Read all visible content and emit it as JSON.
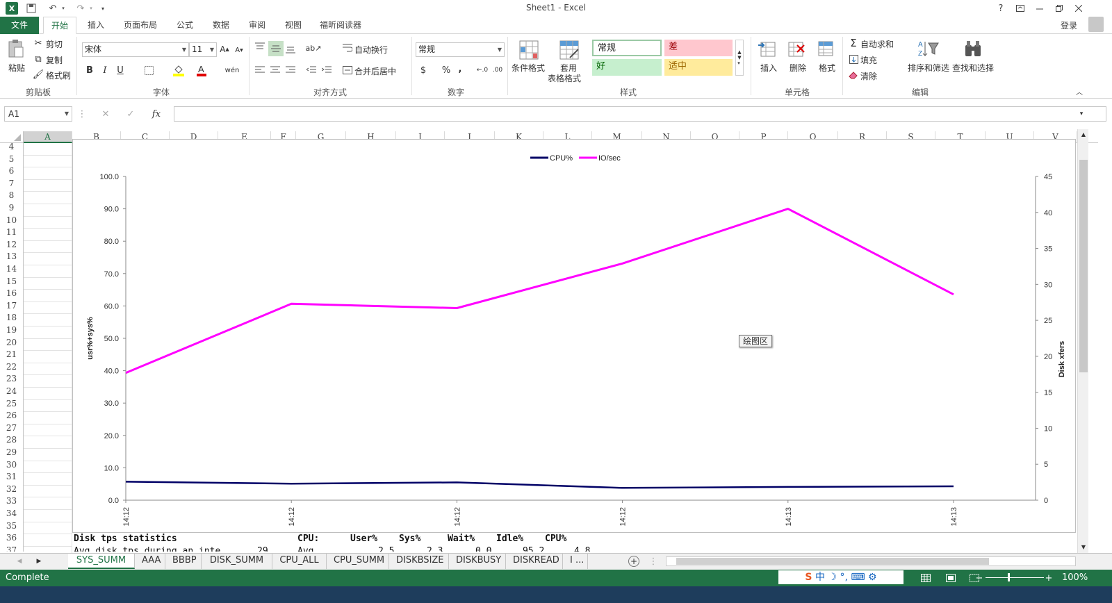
{
  "window": {
    "title": "Sheet1 - Excel",
    "help": "?",
    "signin": "登录"
  },
  "qat": {
    "undo": "↶",
    "redo": "↷"
  },
  "tabs": [
    "文件",
    "开始",
    "插入",
    "页面布局",
    "公式",
    "数据",
    "审阅",
    "视图",
    "福昕阅读器"
  ],
  "ribbon": {
    "clipboard": {
      "label": "剪贴板",
      "paste": "粘贴",
      "cut": "剪切",
      "copy": "复制",
      "format_painter": "格式刷"
    },
    "font": {
      "label": "字体",
      "name": "宋体",
      "size": "11"
    },
    "alignment": {
      "label": "对齐方式",
      "wrap": "自动换行",
      "merge": "合并后居中"
    },
    "number": {
      "label": "数字",
      "format": "常规"
    },
    "styles": {
      "label": "样式",
      "cond_format": "条件格式",
      "table_format_1": "套用",
      "table_format_2": "表格格式",
      "normal": "常规",
      "bad": "差",
      "good": "好",
      "neutral": "适中"
    },
    "cells": {
      "label": "单元格",
      "insert": "插入",
      "delete": "删除",
      "format": "格式"
    },
    "editing": {
      "label": "编辑",
      "autosum": "自动求和",
      "fill": "填充",
      "clear": "清除",
      "sort": "排序和筛选",
      "find": "查找和选择"
    }
  },
  "formula_bar": {
    "name_box": "A1",
    "fx": "fx",
    "value": ""
  },
  "columns": [
    "A",
    "B",
    "C",
    "D",
    "E",
    "F",
    "G",
    "H",
    "I",
    "J",
    "K",
    "L",
    "M",
    "N",
    "O",
    "P",
    "Q",
    "R",
    "S",
    "T",
    "U",
    "V"
  ],
  "rows": [
    "4",
    "5",
    "6",
    "7",
    "8",
    "9",
    "10",
    "11",
    "12",
    "13",
    "14",
    "15",
    "16",
    "17",
    "18",
    "19",
    "20",
    "21",
    "22",
    "23",
    "24",
    "25",
    "26",
    "27",
    "28",
    "29",
    "30",
    "31",
    "32",
    "33",
    "34",
    "35",
    "36",
    "37"
  ],
  "chart_data": {
    "type": "line",
    "title": "",
    "x": [
      "14:12",
      "14:12",
      "14:12",
      "14:12",
      "14:13",
      "14:13"
    ],
    "series": [
      {
        "name": "CPU%",
        "axis": "left",
        "color": "#000066",
        "values": [
          5.7,
          5.1,
          5.5,
          3.8,
          4.1,
          4.3
        ]
      },
      {
        "name": "IO/sec",
        "axis": "right",
        "color": "#ff00ff",
        "values": [
          17.7,
          27.3,
          26.7,
          32.9,
          40.5,
          28.6
        ]
      }
    ],
    "ylabel": "usr%+sys%",
    "y2label": "Disk xfers",
    "ylim": [
      0,
      100
    ],
    "y2lim": [
      0,
      45
    ],
    "yticks": [
      "0.0",
      "10.0",
      "20.0",
      "30.0",
      "40.0",
      "50.0",
      "60.0",
      "70.0",
      "80.0",
      "90.0",
      "100.0"
    ],
    "y2ticks": [
      "0",
      "5",
      "10",
      "15",
      "20",
      "25",
      "30",
      "35",
      "40",
      "45"
    ],
    "legend": "top-center",
    "grid": false,
    "tooltip": "绘图区"
  },
  "bottom_table": {
    "row36": [
      "Disk tps statistics",
      "CPU:",
      "User%",
      "Sys%",
      "Wait%",
      "Idle%",
      "CPU%"
    ],
    "row37": [
      "Avg disk tps during an inte",
      "29",
      "Avg",
      "2.5",
      "2.3",
      "0.0",
      "95.2",
      "4.8"
    ]
  },
  "sheets": [
    "SYS_SUMM",
    "AAA",
    "BBBP",
    "DISK_SUMM",
    "CPU_ALL",
    "CPU_SUMM",
    "DISKBSIZE",
    "DISKBUSY",
    "DISKREAD",
    "I ..."
  ],
  "status": {
    "text": "Complete",
    "zoom": "100%",
    "ime": "中"
  }
}
